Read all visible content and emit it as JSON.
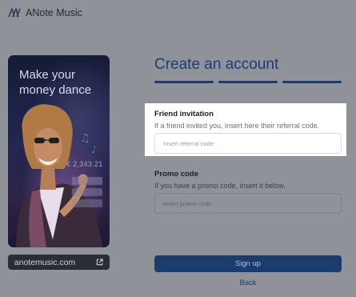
{
  "app": {
    "name": "ANote Music"
  },
  "promo": {
    "headline": "Make your money dance",
    "balance": "€ 2,343.21",
    "link_label": "anotemusic.com",
    "link_icon": "external-link-icon"
  },
  "form": {
    "title": "Create an account",
    "steps_total": 3,
    "friend": {
      "label": "Friend invitation",
      "hint": "If a friend invited you, insert here their referral code.",
      "placeholder": "Insert referral code"
    },
    "promo_code": {
      "label": "Promo code",
      "hint": "If you have a promo code, insert it below.",
      "placeholder": "Insert promo code"
    },
    "signup_label": "Sign up",
    "back_label": "Back"
  },
  "colors": {
    "overlay": "#8f9299",
    "primary": "#1b3b6c",
    "title": "#1a3e75",
    "highlight": "#ffffff"
  }
}
